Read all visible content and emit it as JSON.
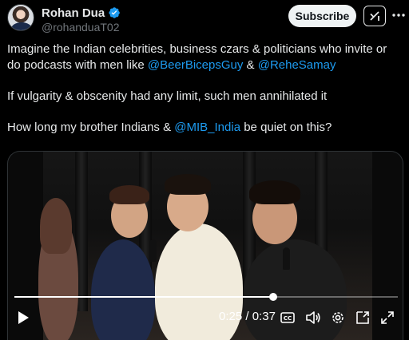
{
  "author": {
    "name": "Rohan Dua",
    "handle": "@rohanduaT02",
    "verified": true
  },
  "actions": {
    "subscribe_label": "Subscribe",
    "grok_icon": "grok-icon",
    "more_icon": "more-icon"
  },
  "tweet": {
    "para1": {
      "text": "Imagine the Indian celebrities, business czars & politicians who invite or do podcasts with men like ",
      "mention1": "@BeerBicepsGuy",
      "middle": " & ",
      "mention2": "@ReheSamay"
    },
    "para2": "If vulgarity & obscenity had any limit, such men annihilated it",
    "para3": {
      "before": "How long my brother Indians & ",
      "mention": "@MIB_India",
      "after": " be quiet on this?"
    }
  },
  "video": {
    "current_time": "0:25",
    "separator": " / ",
    "duration": "0:37",
    "progress": 0.676,
    "controls": [
      "play-icon",
      "captions-icon",
      "volume-icon",
      "settings-icon",
      "picture-in-picture-icon",
      "fullscreen-icon"
    ]
  },
  "colors": {
    "mention": "#1d9bf0",
    "verified": "#1d9bf0",
    "background": "#000000"
  }
}
